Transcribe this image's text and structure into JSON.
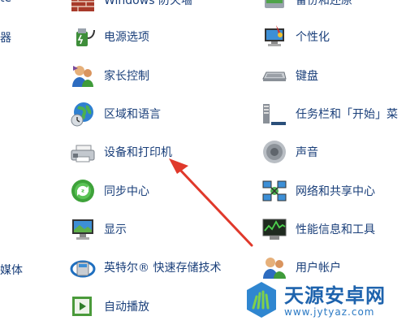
{
  "left_partial": {
    "top_fragment": "te",
    "mid_fragment": "器",
    "bottom_fragment": "媒体"
  },
  "middle_column": {
    "items": [
      {
        "label": "Windows 防火墙",
        "icon": "firewall-icon"
      },
      {
        "label": "电源选项",
        "icon": "power-options-icon"
      },
      {
        "label": "家长控制",
        "icon": "parental-controls-icon"
      },
      {
        "label": "区域和语言",
        "icon": "region-language-icon"
      },
      {
        "label": "设备和打印机",
        "icon": "devices-printers-icon"
      },
      {
        "label": "同步中心",
        "icon": "sync-center-icon"
      },
      {
        "label": "显示",
        "icon": "display-icon"
      },
      {
        "label": "英特尔® 快速存储技术",
        "icon": "intel-rst-icon"
      },
      {
        "label": "自动播放",
        "icon": "autoplay-icon"
      }
    ]
  },
  "right_column": {
    "items": [
      {
        "label": "备份和还原",
        "icon": "backup-restore-icon"
      },
      {
        "label": "个性化",
        "icon": "personalization-icon"
      },
      {
        "label": "键盘",
        "icon": "keyboard-icon"
      },
      {
        "label": "任务栏和「开始」菜",
        "icon": "taskbar-start-icon"
      },
      {
        "label": "声音",
        "icon": "sound-icon"
      },
      {
        "label": "网络和共享中心",
        "icon": "network-sharing-icon"
      },
      {
        "label": "性能信息和工具",
        "icon": "performance-icon"
      },
      {
        "label": "用户帐户",
        "icon": "user-accounts-icon"
      }
    ]
  },
  "watermark": {
    "name": "天源安卓网",
    "url": "www.jytyaz.com"
  },
  "colors": {
    "link": "#1a3f7a",
    "arrow": "#e0392b",
    "watermark": "#1e63ad"
  }
}
